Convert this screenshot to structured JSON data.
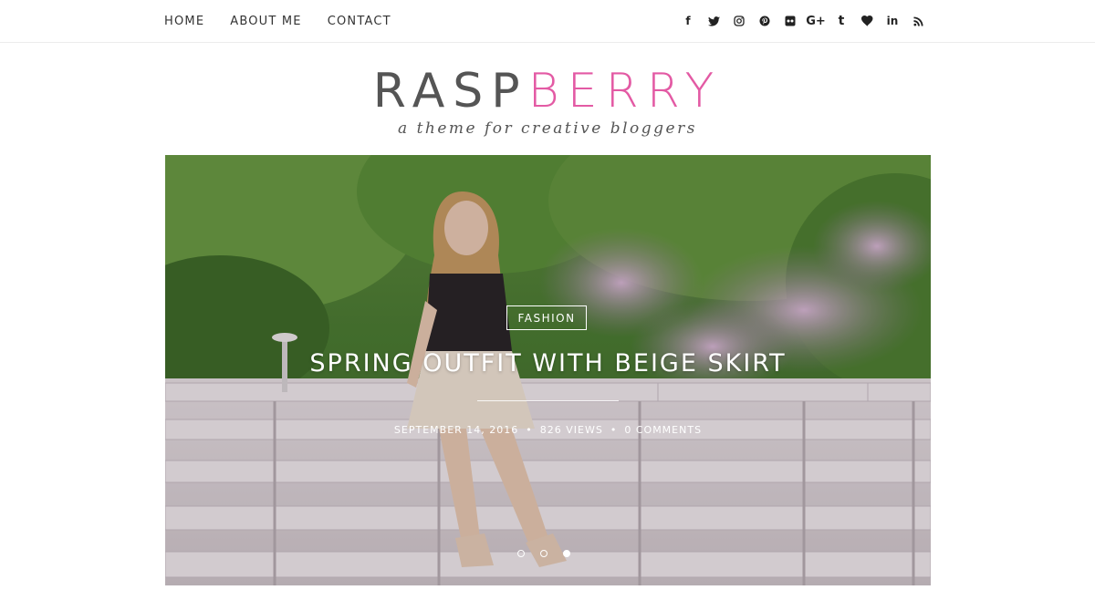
{
  "nav": {
    "items": [
      "HOME",
      "ABOUT ME",
      "CONTACT"
    ]
  },
  "social": {
    "icons": [
      "facebook-icon",
      "twitter-icon",
      "instagram-icon",
      "pinterest-icon",
      "flickr-icon",
      "google-plus-icon",
      "tumblr-icon",
      "heart-icon",
      "linkedin-icon",
      "rss-icon"
    ],
    "google_plus_glyph": "G+",
    "tumblr_glyph": "t",
    "linkedin_glyph": "in",
    "facebook_glyph": "f"
  },
  "brand": {
    "name_part1": "RASP",
    "name_part2": "BERRY",
    "tagline": "a theme for creative bloggers",
    "accent_color": "#e35aa4"
  },
  "hero": {
    "category": "FASHION",
    "title": "SPRING OUTFIT WITH BEIGE SKIRT",
    "date": "SEPTEMBER 14, 2016",
    "views": "826 VIEWS",
    "comments": "0 COMMENTS",
    "separator": "•",
    "slides": 3,
    "active_slide": 3
  }
}
